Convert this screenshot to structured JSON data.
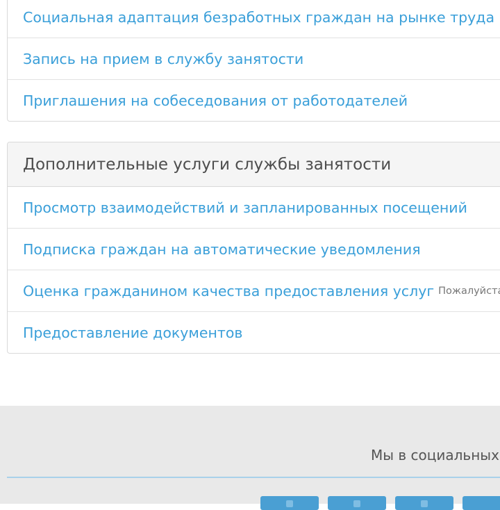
{
  "panel_top": {
    "links": [
      "Социальная адаптация безработных граждан на рынке труда",
      "Запись на прием в службу занятости",
      "Приглашения на собеседования от работодателей"
    ]
  },
  "panel_bottom": {
    "heading": "Дополнительные услуги службы занятости",
    "links": [
      "Просмотр взаимодействий и запланированных посещений",
      "Подписка граждан на автоматические уведомления",
      "Оценка гражданином качества предоставления услуг",
      "Предоставление документов"
    ],
    "rating_hint": "Пожалуйста, оц"
  },
  "footer": {
    "social_title": "Мы в социальных",
    "social_buttons": [
      "social-button-1",
      "social-button-2",
      "social-button-3",
      "social-button-4"
    ]
  },
  "colors": {
    "link": "#3a9fd9",
    "footer_bg": "#e9e9e9",
    "footer_line": "#a9d1ea",
    "social_btn": "#4a9fd3"
  }
}
